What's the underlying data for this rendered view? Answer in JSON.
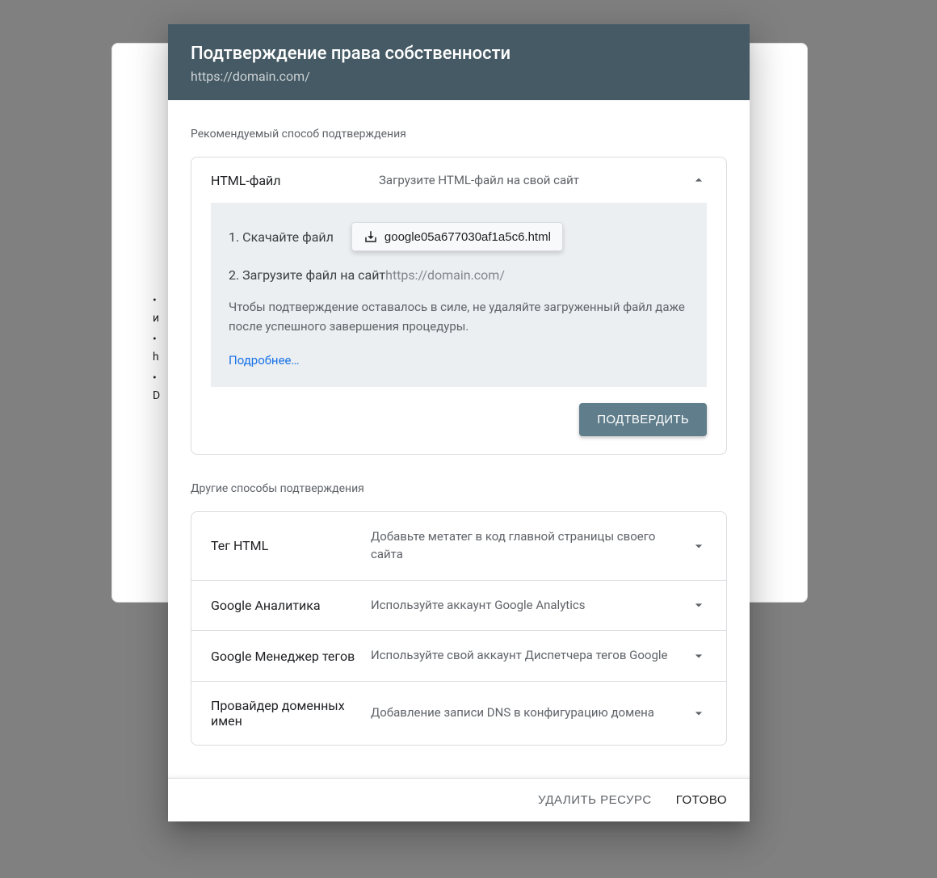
{
  "dialog": {
    "title": "Подтверждение права собственности",
    "subtitle": "https://domain.com/",
    "recommended_label": "Рекомендуемый способ подтверждения",
    "other_label": "Другие способы подтверждения"
  },
  "recommended": {
    "title": "HTML-файл",
    "description": "Загрузите HTML-файл на свой сайт",
    "expanded": true,
    "steps": {
      "step1_label": "1. Скачайте файл",
      "download_file": "google05a677030af1a5c6.html",
      "step2_label": "2. Загрузите файл на сайт ",
      "step2_url": "https://domain.com/"
    },
    "retain_note": "Чтобы подтверждение оставалось в силе, не удаляйте загруженный файл даже после успешного завершения процедуры.",
    "more_link": "Подробнее…",
    "confirm_button": "ПОДТВЕРДИТЬ"
  },
  "other_methods": [
    {
      "title": "Тег HTML",
      "description": "Добавьте метатег в код главной страницы своего сайта"
    },
    {
      "title": "Google Аналитика",
      "description": "Используйте аккаунт Google Analytics"
    },
    {
      "title": "Google Менеджер тегов",
      "description": "Используйте свой аккаунт Диспетчера тегов Google"
    },
    {
      "title": "Провайдер доменных имен",
      "description": "Добавление записи DNS в конфигурацию домена"
    }
  ],
  "footer": {
    "remove": "УДАЛИТЬ РЕСУРС",
    "done": "ГОТОВО"
  },
  "background_partial_text": {
    "line1": "и",
    "line2": "h",
    "line3": "D"
  }
}
